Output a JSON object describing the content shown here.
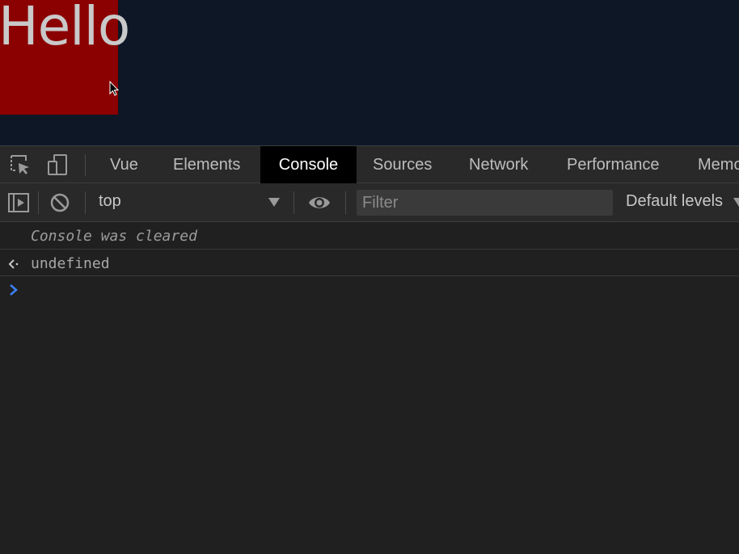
{
  "page": {
    "hello_text": "Hello",
    "box_color": "#8b0000",
    "background_color": "#0d1726"
  },
  "devtools": {
    "tabs": [
      {
        "label": "Vue",
        "active": false
      },
      {
        "label": "Elements",
        "active": false
      },
      {
        "label": "Console",
        "active": true
      },
      {
        "label": "Sources",
        "active": false
      },
      {
        "label": "Network",
        "active": false
      },
      {
        "label": "Performance",
        "active": false
      },
      {
        "label": "Memo",
        "active": false
      }
    ],
    "toolbar": {
      "context": "top",
      "filter_placeholder": "Filter",
      "levels": "Default levels"
    },
    "console": {
      "messages": [
        {
          "text": "Console was cleared",
          "style": "italic"
        },
        {
          "text": "undefined",
          "style": "result"
        }
      ],
      "prompt_color": "#3b82f6"
    }
  }
}
